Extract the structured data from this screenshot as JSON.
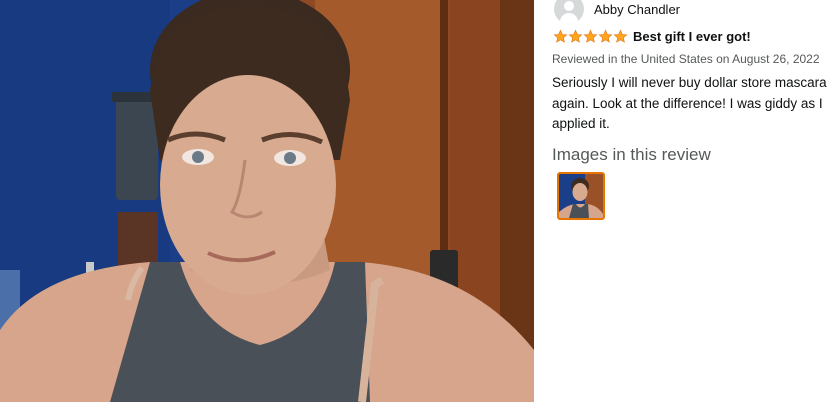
{
  "review": {
    "reviewer_name": "Abby Chandler",
    "rating": 5,
    "rating_max": 5,
    "title": "Best gift I ever got!",
    "date_line": "Reviewed in the United States on August 26, 2022",
    "body": "Seriously I will never buy dollar store mascara again. Look at the difference! I was giddy as I applied it.",
    "images_heading": "Images in this review"
  },
  "colors": {
    "star": "#ffa41c",
    "thumb_border": "#e77600",
    "text_primary": "#0f1111",
    "text_secondary": "#565959"
  },
  "icons": {
    "avatar": "default-user-avatar-icon",
    "star": "filled-star-icon"
  }
}
